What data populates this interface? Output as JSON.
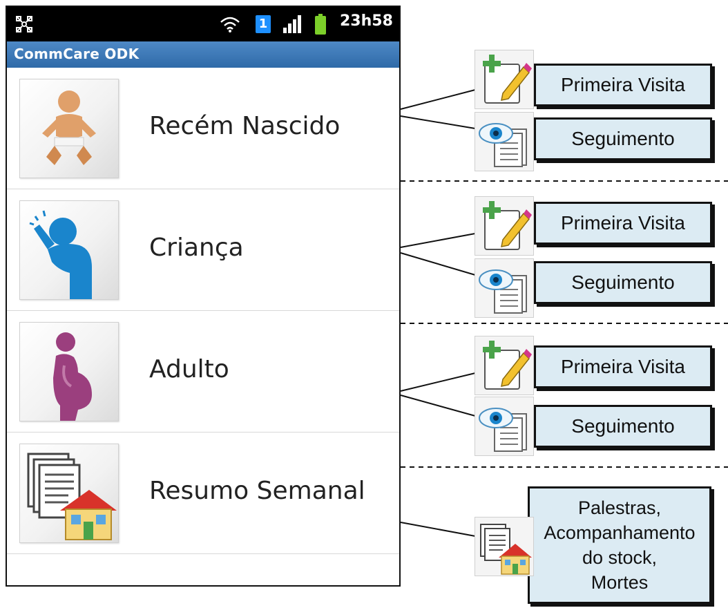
{
  "status_bar": {
    "sim_slot": "1",
    "time": "23h58"
  },
  "app": {
    "title": "CommCare ODK"
  },
  "menu": [
    {
      "label": "Recém Nascido",
      "icon": "baby-icon"
    },
    {
      "label": "Criança",
      "icon": "child-icon"
    },
    {
      "label": "Adulto",
      "icon": "pregnant-woman-icon"
    },
    {
      "label": "Resumo Semanal",
      "icon": "report-house-icon"
    }
  ],
  "annotations": [
    {
      "first": "Primeira Visita",
      "follow": "Seguimento"
    },
    {
      "first": "Primeira Visita",
      "follow": "Seguimento"
    },
    {
      "first": "Primeira Visita",
      "follow": "Seguimento"
    }
  ],
  "summary_annotation": {
    "lines": [
      "Palestras,",
      "Acompanhamento",
      "do stock,",
      "Mortes"
    ]
  },
  "colors": {
    "title_bar": "#3d79b8",
    "annotation_box": "#dcebf3",
    "child_blue": "#1a85cc",
    "adult_purple": "#9b3f7e"
  }
}
